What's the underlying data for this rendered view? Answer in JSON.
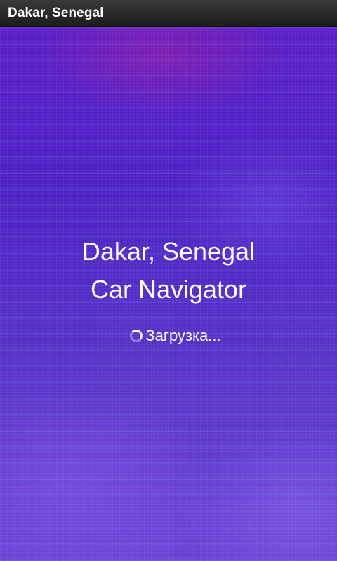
{
  "window": {
    "title": "Dakar, Senegal"
  },
  "splash": {
    "title_line1": "Dakar, Senegal",
    "title_line2": "Car Navigator",
    "loading_text": "Загрузка..."
  },
  "icons": {
    "spinner": "loading-spinner-icon"
  },
  "colors": {
    "background": "#5a2fc0",
    "title_bar": "#2a2a2a",
    "text": "#ffffff"
  }
}
